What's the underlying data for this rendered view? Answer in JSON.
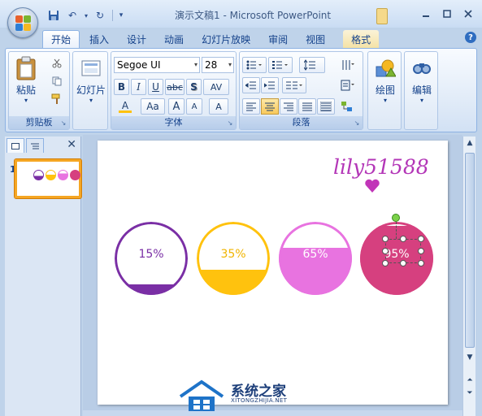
{
  "window": {
    "title": "演示文稿1 - Microsoft PowerPoint",
    "controls": [
      "minimize",
      "maximize",
      "close"
    ]
  },
  "quick_access": {
    "icons": [
      "save-icon",
      "undo-icon",
      "redo-icon",
      "customize-icon"
    ]
  },
  "tabs": [
    {
      "label": "开始",
      "active": true
    },
    {
      "label": "插入"
    },
    {
      "label": "设计"
    },
    {
      "label": "动画"
    },
    {
      "label": "幻灯片放映"
    },
    {
      "label": "审阅"
    },
    {
      "label": "视图"
    },
    {
      "label": "格式",
      "contextual": true
    }
  ],
  "ribbon": {
    "clipboard": {
      "label": "剪贴板",
      "paste": "粘贴"
    },
    "slides": {
      "new_slide": "幻灯片"
    },
    "font": {
      "label": "字体",
      "name": "Segoe UI",
      "size": "28",
      "bold": "B",
      "italic": "I",
      "underline": "U",
      "strike": "abc",
      "shadow": "S",
      "spacing": "AV",
      "color": "A",
      "case": "Aa",
      "grow": "A",
      "shrink": "A",
      "clear": "A"
    },
    "paragraph": {
      "label": "段落"
    },
    "drawing": {
      "label": "绘图"
    },
    "editing": {
      "label": "编辑"
    }
  },
  "slides_pane": {
    "slide_number": "1"
  },
  "slide": {
    "signature": "lily51588",
    "gauges": [
      {
        "label": "15%",
        "value": 0.15,
        "color": "#7a2fa5",
        "label_color": "#7a2fa5"
      },
      {
        "label": "35%",
        "value": 0.35,
        "color": "#ffc20e",
        "label_color": "#f0b400"
      },
      {
        "label": "65%",
        "value": 0.65,
        "color": "#e873e0",
        "label_color": "#ffffff"
      },
      {
        "label": "95%",
        "value": 0.95,
        "color": "#d6407f",
        "label_color": "#ffffff"
      }
    ]
  },
  "watermark": {
    "title": "系统之家",
    "subtitle": "XITONGZHIJIA.NET"
  }
}
